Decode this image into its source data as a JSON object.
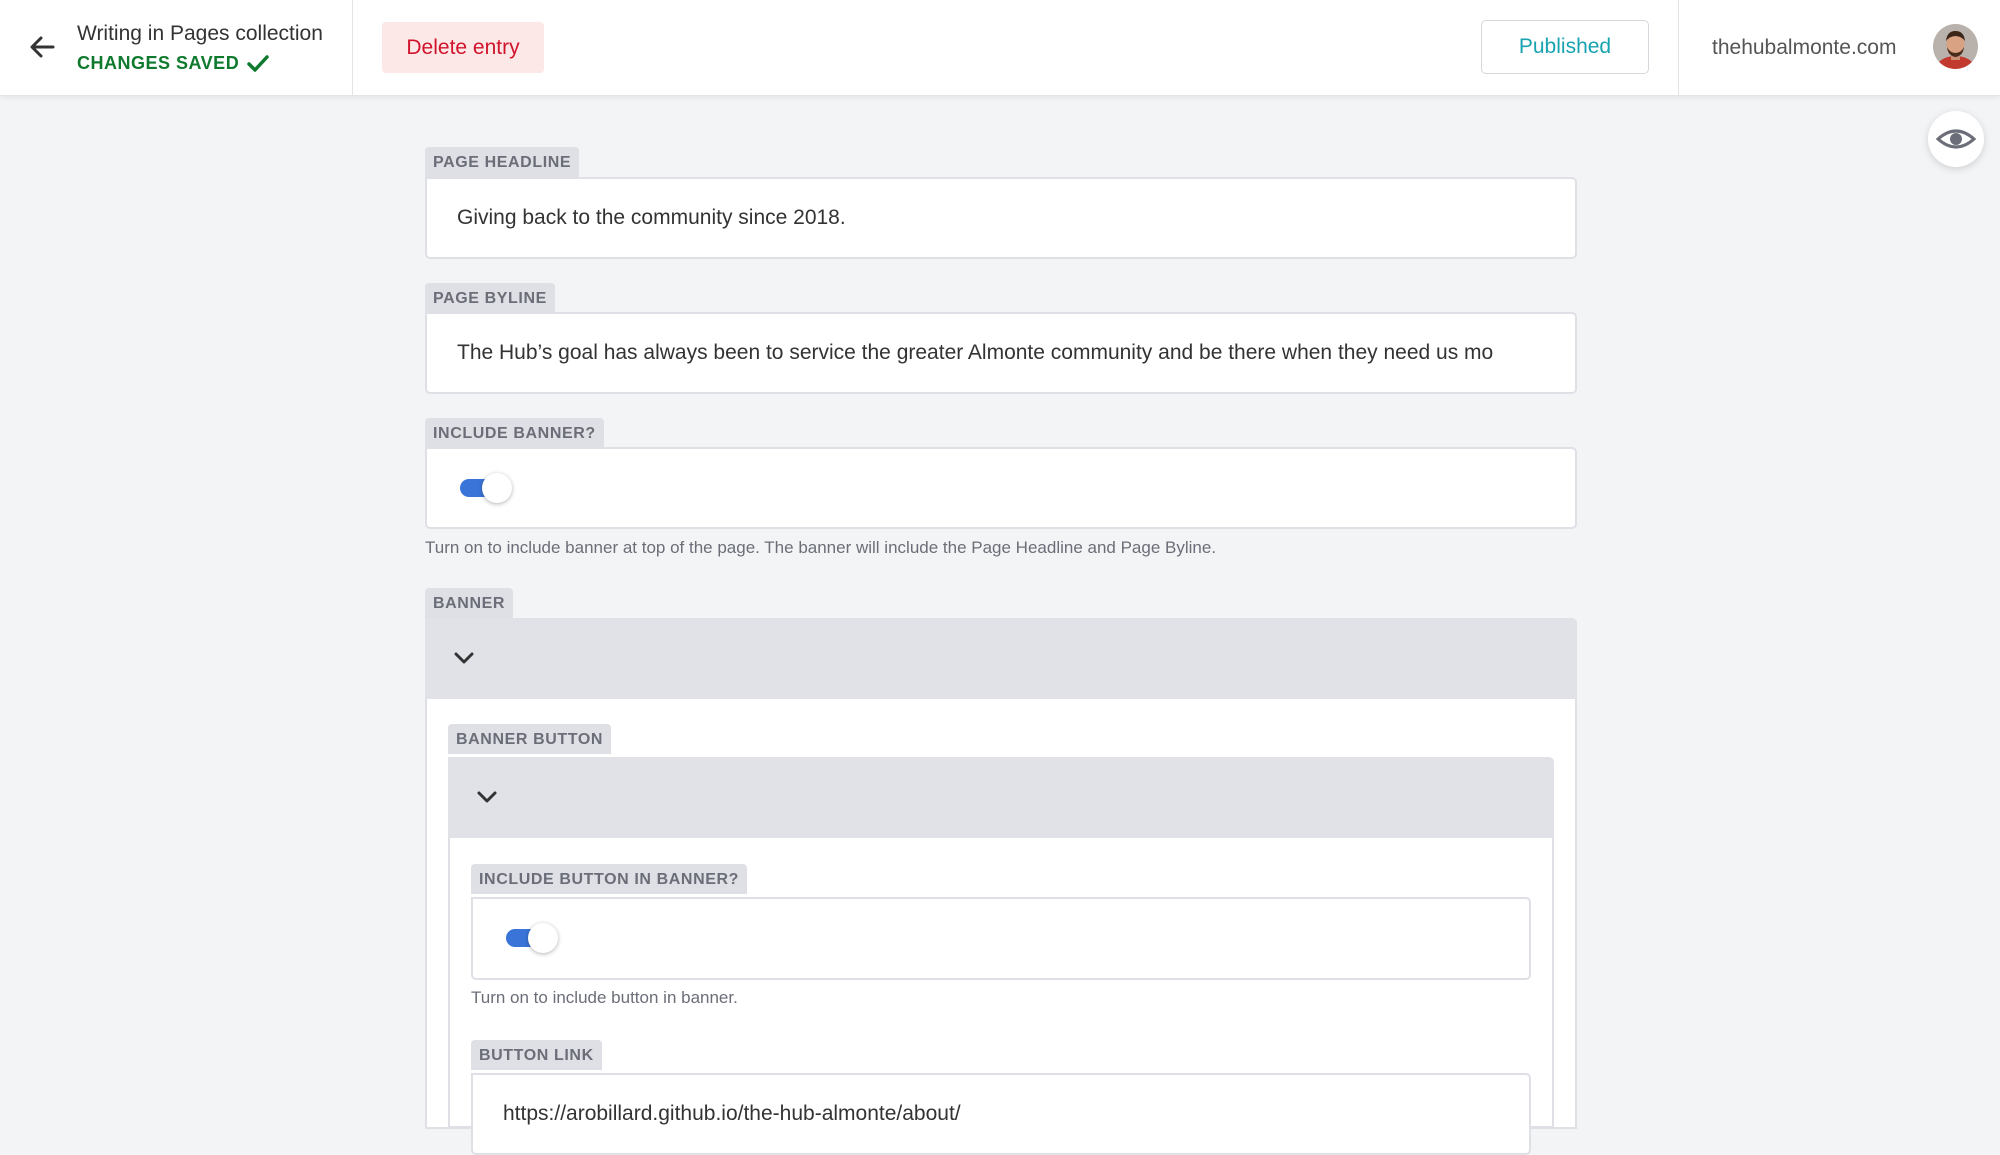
{
  "header": {
    "collection_title": "Writing in Pages collection",
    "save_status": "CHANGES SAVED",
    "delete_label": "Delete entry",
    "status_label": "Published",
    "site_name": "thehubalmonte.com"
  },
  "fields": {
    "page_headline": {
      "label": "PAGE HEADLINE",
      "value": "Giving back to the community since 2018."
    },
    "page_byline": {
      "label": "PAGE BYLINE",
      "value": "The Hub’s goal has always been to service the greater Almonte community and be there when they need us mo"
    },
    "include_banner": {
      "label": "INCLUDE BANNER?",
      "checked": true,
      "hint": "Turn on to include banner at top of the page. The banner will include the Page Headline and Page Byline."
    },
    "banner": {
      "label": "BANNER",
      "banner_button": {
        "label": "BANNER BUTTON",
        "include_button": {
          "label": "INCLUDE BUTTON IN BANNER?",
          "checked": true,
          "hint": "Turn on to include button in banner."
        },
        "button_link": {
          "label": "BUTTON LINK",
          "value": "https://arobillard.github.io/the-hub-almonte/about/"
        }
      }
    }
  },
  "colors": {
    "accent_blue": "#3a74d8",
    "saved_green": "#0f7a2e",
    "delete_red": "#d0142c",
    "published_teal": "#17a3b0"
  },
  "icons": [
    "arrow-left-icon",
    "checkmark-icon",
    "eye-icon",
    "chevron-down-icon"
  ]
}
